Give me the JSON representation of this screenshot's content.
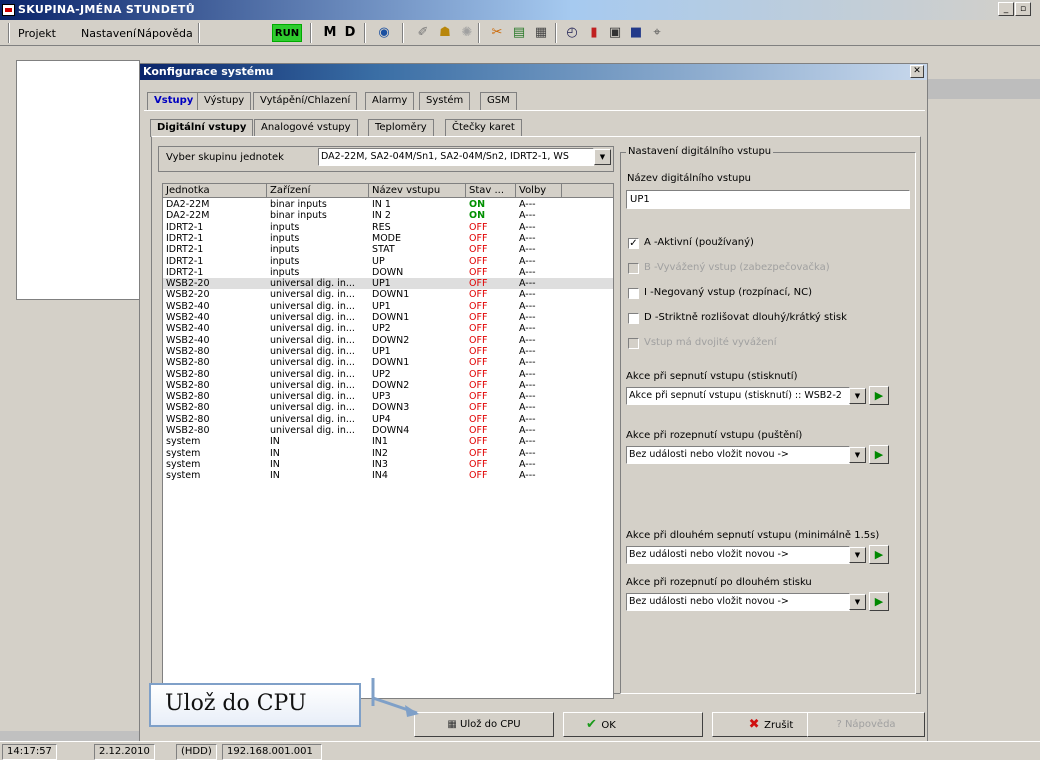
{
  "window": {
    "title": "SKUPINA-JMÉNA STUNDETŮ"
  },
  "menubar": {
    "items": [
      "Projekt",
      "Nastavení",
      "Nápověda"
    ],
    "run_label": "RUN",
    "m_label": "M",
    "d_label": "D"
  },
  "dialog": {
    "title": "Konfigurace systému",
    "tabs": [
      "Vstupy",
      "Výstupy",
      "Vytápění/Chlazení",
      "Alarmy",
      "Systém",
      "GSM"
    ],
    "subtabs": [
      "Digitální vstupy",
      "Analogové vstupy",
      "Teploměry",
      "Čtečky karet"
    ],
    "group_label": "Vyber skupinu jednotek",
    "group_value": "DA2-22M, SA2-04M/Sn1, SA2-04M/Sn2, IDRT2-1, WS"
  },
  "table": {
    "headers": [
      "Jednotka",
      "Zařízení",
      "Název vstupu",
      "Stav ...",
      "Volby"
    ],
    "rows": [
      [
        "DA2-22M",
        "binar inputs",
        "IN 1",
        "ON",
        "A---"
      ],
      [
        "DA2-22M",
        "binar inputs",
        "IN 2",
        "ON",
        "A---"
      ],
      [
        "IDRT2-1",
        "inputs",
        "RES",
        "OFF",
        "A---"
      ],
      [
        "IDRT2-1",
        "inputs",
        "MODE",
        "OFF",
        "A---"
      ],
      [
        "IDRT2-1",
        "inputs",
        "STAT",
        "OFF",
        "A---"
      ],
      [
        "IDRT2-1",
        "inputs",
        "UP",
        "OFF",
        "A---"
      ],
      [
        "IDRT2-1",
        "inputs",
        "DOWN",
        "OFF",
        "A---"
      ],
      [
        "WSB2-20",
        "universal dig. in...",
        "UP1",
        "OFF",
        "A---"
      ],
      [
        "WSB2-20",
        "universal dig. in...",
        "DOWN1",
        "OFF",
        "A---"
      ],
      [
        "WSB2-40",
        "universal dig. in...",
        "UP1",
        "OFF",
        "A---"
      ],
      [
        "WSB2-40",
        "universal dig. in...",
        "DOWN1",
        "OFF",
        "A---"
      ],
      [
        "WSB2-40",
        "universal dig. in...",
        "UP2",
        "OFF",
        "A---"
      ],
      [
        "WSB2-40",
        "universal dig. in...",
        "DOWN2",
        "OFF",
        "A---"
      ],
      [
        "WSB2-80",
        "universal dig. in...",
        "UP1",
        "OFF",
        "A---"
      ],
      [
        "WSB2-80",
        "universal dig. in...",
        "DOWN1",
        "OFF",
        "A---"
      ],
      [
        "WSB2-80",
        "universal dig. in...",
        "UP2",
        "OFF",
        "A---"
      ],
      [
        "WSB2-80",
        "universal dig. in...",
        "DOWN2",
        "OFF",
        "A---"
      ],
      [
        "WSB2-80",
        "universal dig. in...",
        "UP3",
        "OFF",
        "A---"
      ],
      [
        "WSB2-80",
        "universal dig. in...",
        "DOWN3",
        "OFF",
        "A---"
      ],
      [
        "WSB2-80",
        "universal dig. in...",
        "UP4",
        "OFF",
        "A---"
      ],
      [
        "WSB2-80",
        "universal dig. in...",
        "DOWN4",
        "OFF",
        "A---"
      ],
      [
        "system",
        "IN",
        "IN1",
        "OFF",
        "A---"
      ],
      [
        "system",
        "IN",
        "IN2",
        "OFF",
        "A---"
      ],
      [
        "system",
        "IN",
        "IN3",
        "OFF",
        "A---"
      ],
      [
        "system",
        "IN",
        "IN4",
        "OFF",
        "A---"
      ]
    ],
    "selected_row": 7
  },
  "settings": {
    "group_title": "Nastavení digitálního vstupu",
    "name_label": "Název digitálního vstupu",
    "name_value": "UP1",
    "checkboxes": [
      {
        "label": "A -Aktivní (používaný)",
        "checked": true,
        "enabled": true
      },
      {
        "label": "B -Vyvážený vstup (zabezpečovačka)",
        "checked": false,
        "enabled": false
      },
      {
        "label": "I -Negovaný vstup (rozpínací, NC)",
        "checked": false,
        "enabled": true
      },
      {
        "label": "D -Striktně rozlišovat dlouhý/krátký stisk",
        "checked": false,
        "enabled": true
      },
      {
        "label": "Vstup má dvojité vyvážení",
        "checked": false,
        "enabled": false
      }
    ],
    "actions": [
      {
        "label": "Akce při sepnutí vstupu (stisknutí)",
        "value": "Akce při sepnutí vstupu (stisknutí) :: WSB2-2"
      },
      {
        "label": "Akce při rozepnutí vstupu (puštění)",
        "value": "Bez události nebo vložit novou ->"
      },
      {
        "label": "Akce při dlouhém sepnutí vstupu (minimálně 1.5s)",
        "value": "Bez události nebo vložit novou ->"
      },
      {
        "label": "Akce při rozepnutí po dlouhém stisku",
        "value": "Bez události nebo vložit novou ->"
      }
    ]
  },
  "buttons": {
    "save_cpu": "Ulož do CPU",
    "ok": "OK",
    "cancel": "Zrušit",
    "help": "Nápověda"
  },
  "callout": {
    "text": "Ulož do CPU"
  },
  "statusbar": {
    "time": "14:17:57",
    "date": "2.12.2010",
    "drive": "(HDD)",
    "ip": "192.168.001.001"
  },
  "colors": {
    "on": "#009000",
    "off": "#e00000",
    "run": "#2ecc2e",
    "title": "#0a246a"
  }
}
